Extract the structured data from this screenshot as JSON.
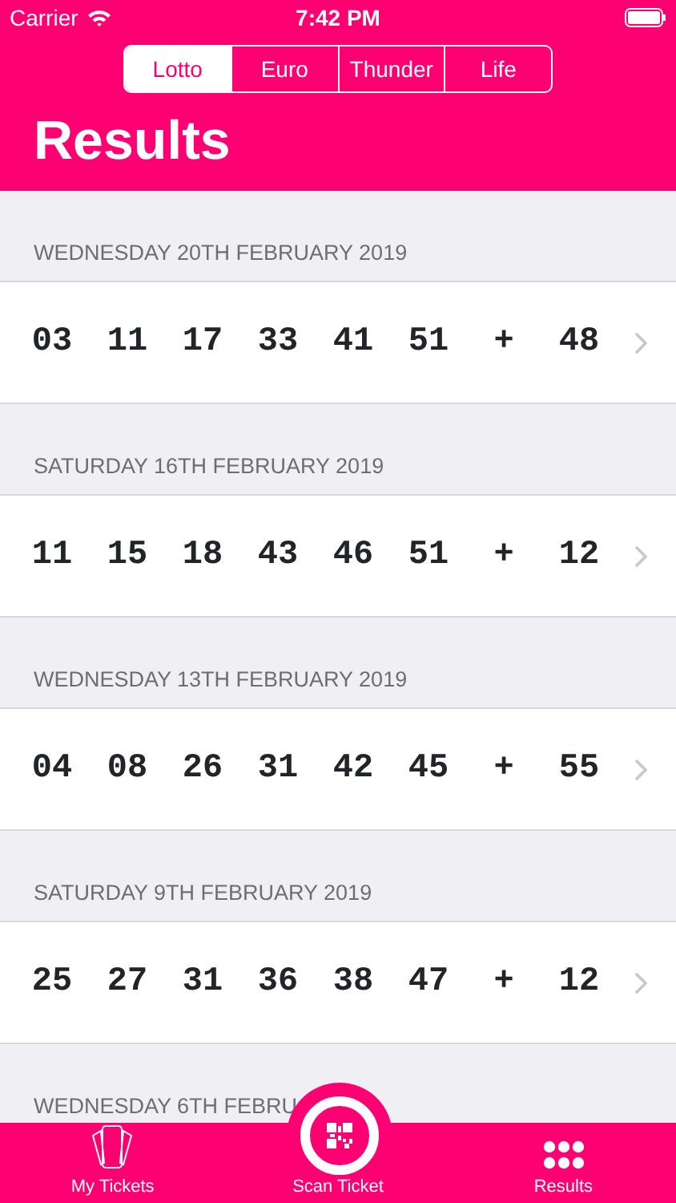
{
  "status_bar": {
    "carrier": "Carrier",
    "time": "7:42 PM"
  },
  "tabs": [
    {
      "label": "Lotto",
      "selected": true
    },
    {
      "label": "Euro",
      "selected": false
    },
    {
      "label": "Thunder",
      "selected": false
    },
    {
      "label": "Life",
      "selected": false
    }
  ],
  "title": "Results",
  "draws": [
    {
      "date": "WEDNESDAY 20TH FEBRUARY 2019",
      "numbers": [
        "03",
        "11",
        "17",
        "33",
        "41",
        "51"
      ],
      "plus": "+",
      "bonus": "48"
    },
    {
      "date": "SATURDAY 16TH FEBRUARY 2019",
      "numbers": [
        "11",
        "15",
        "18",
        "43",
        "46",
        "51"
      ],
      "plus": "+",
      "bonus": "12"
    },
    {
      "date": "WEDNESDAY 13TH FEBRUARY 2019",
      "numbers": [
        "04",
        "08",
        "26",
        "31",
        "42",
        "45"
      ],
      "plus": "+",
      "bonus": "55"
    },
    {
      "date": "SATURDAY 9TH FEBRUARY 2019",
      "numbers": [
        "25",
        "27",
        "31",
        "36",
        "38",
        "47"
      ],
      "plus": "+",
      "bonus": "12"
    },
    {
      "date": "WEDNESDAY 6TH FEBRU"
    }
  ],
  "tab_bar": [
    {
      "kind": "tickets",
      "label": "My Tickets"
    },
    {
      "kind": "scan",
      "label": "Scan Ticket"
    },
    {
      "kind": "results",
      "label": "Results"
    }
  ]
}
